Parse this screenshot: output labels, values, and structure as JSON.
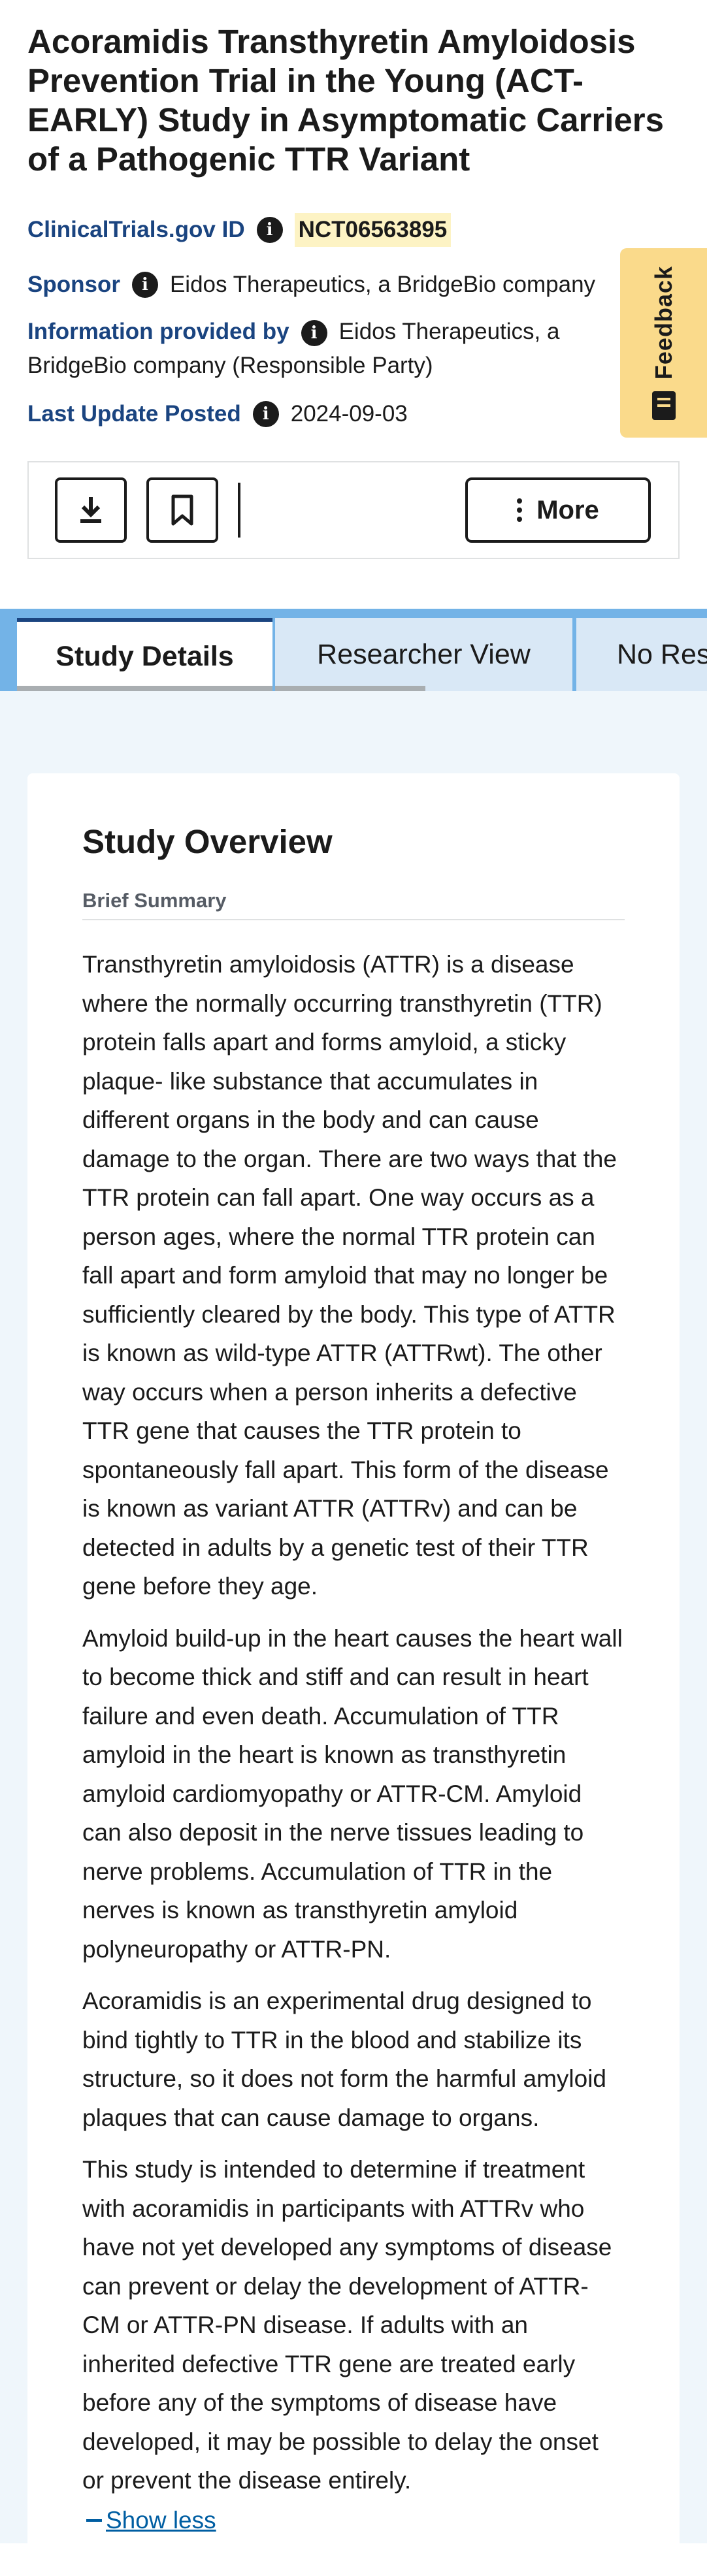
{
  "study": {
    "title": "Acoramidis Transthyretin Amyloidosis Prevention Trial in the Young (ACT-EARLY) Study in Asymptomatic Carriers of a Pathogenic TTR Variant",
    "id_label": "ClinicalTrials.gov ID",
    "id_value": "NCT06563895",
    "sponsor_label": "Sponsor",
    "sponsor_value": "Eidos Therapeutics, a BridgeBio company",
    "provided_label": "Information provided by",
    "provided_value": "Eidos Therapeutics, a BridgeBio company (Responsible Party)",
    "updated_label": "Last Update Posted",
    "updated_value": "2024-09-03"
  },
  "feedback": {
    "label": "Feedback",
    "icon": "feedback-icon"
  },
  "toolbar": {
    "download_icon": "download-icon",
    "bookmark_icon": "bookmark-icon",
    "more_label": "More"
  },
  "tabs": [
    {
      "label": "Study Details",
      "active": true
    },
    {
      "label": "Researcher View",
      "active": false
    },
    {
      "label": "No Results Posted",
      "active": false
    }
  ],
  "overview": {
    "heading": "Study Overview",
    "section_label": "Brief Summary",
    "paragraphs": [
      "Transthyretin amyloidosis (ATTR) is a disease where the normally occurring transthyretin (TTR) protein falls apart and forms amyloid, a sticky plaque- like substance that accumulates in different organs in the body and can cause damage to the organ. There are two ways that the TTR protein can fall apart. One way occurs as a person ages, where the normal TTR protein can fall apart and form amyloid that may no longer be sufficiently cleared by the body. This type of ATTR is known as wild-type ATTR (ATTRwt). The other way occurs when a person inherits a defective TTR gene that causes the TTR protein to spontaneously fall apart. This form of the disease is known as variant ATTR (ATTRv) and can be detected in adults by a genetic test of their TTR gene before they age.",
      "Amyloid build-up in the heart causes the heart wall to become thick and stiff and can result in heart failure and even death. Accumulation of TTR amyloid in the heart is known as transthyretin amyloid cardiomyopathy or ATTR-CM. Amyloid can also deposit in the nerve tissues leading to nerve problems. Accumulation of TTR in the nerves is known as transthyretin amyloid polyneuropathy or ATTR-PN.",
      "Acoramidis is an experimental drug designed to bind tightly to TTR in the blood and stabilize its structure, so it does not form the harmful amyloid plaques that can cause damage to organs.",
      "This study is intended to determine if treatment with acoramidis in participants with ATTRv who have not yet developed any symptoms of disease can prevent or delay the development of ATTR-CM or ATTR-PN disease. If adults with an inherited defective TTR gene are treated early before any of the symptoms of disease have developed, it may be possible to delay the onset or prevent the disease entirely."
    ],
    "show_less_label": "Show less"
  }
}
